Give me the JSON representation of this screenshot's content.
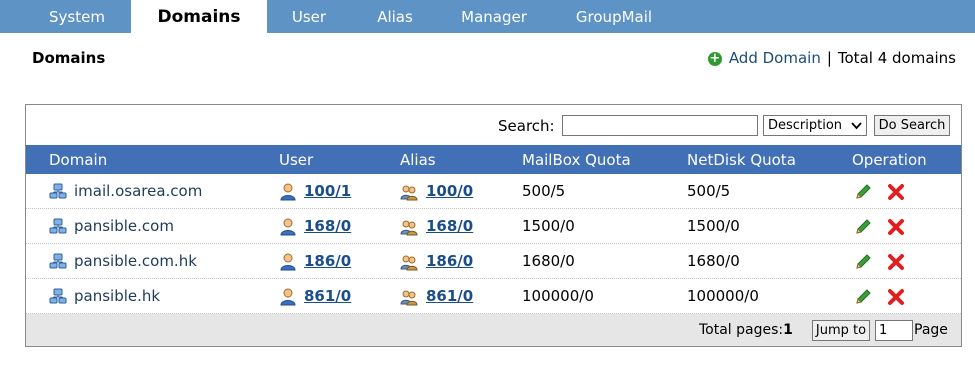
{
  "nav": {
    "tabs": [
      {
        "label": "System"
      },
      {
        "label": "Domains",
        "active": true
      },
      {
        "label": "User"
      },
      {
        "label": "Alias"
      },
      {
        "label": "Manager"
      },
      {
        "label": "GroupMail"
      }
    ]
  },
  "header": {
    "title": "Domains",
    "add_label": "Add Domain",
    "separator": "|",
    "total_text": "Total 4 domains"
  },
  "search": {
    "label": "Search:",
    "value": "",
    "selected_field": "Description",
    "button_label": "Do Search"
  },
  "table": {
    "columns": [
      "Domain",
      "User",
      "Alias",
      "MailBox Quota",
      "NetDisk Quota",
      "Operation"
    ],
    "rows": [
      {
        "domain": "imail.osarea.com",
        "user": "100/1",
        "alias": "100/0",
        "mailbox_quota": "500/5",
        "netdisk_quota": "500/5"
      },
      {
        "domain": "pansible.com",
        "user": "168/0",
        "alias": "168/0",
        "mailbox_quota": "1500/0",
        "netdisk_quota": "1500/0"
      },
      {
        "domain": "pansible.com.hk",
        "user": "186/0",
        "alias": "186/0",
        "mailbox_quota": "1680/0",
        "netdisk_quota": "1680/0"
      },
      {
        "domain": "pansible.hk",
        "user": "861/0",
        "alias": "861/0",
        "mailbox_quota": "100000/0",
        "netdisk_quota": "100000/0"
      }
    ]
  },
  "pagination": {
    "total_label": "Total pages:",
    "total_pages": "1",
    "jump_label": "Jump to",
    "page_value": "1",
    "page_suffix": "Page"
  },
  "colors": {
    "nav_bg": "#5e93c6",
    "table_header_bg": "#4270b6",
    "link": "#1a4d8c",
    "delete": "#e02020",
    "edit": "#3aa13a",
    "add": "#2f9a2f"
  },
  "icons": {
    "domain": "network-computer-icon",
    "user": "user-icon",
    "alias": "users-group-icon",
    "edit": "pencil-icon",
    "delete": "red-x-icon",
    "add": "plus-circle-icon"
  }
}
